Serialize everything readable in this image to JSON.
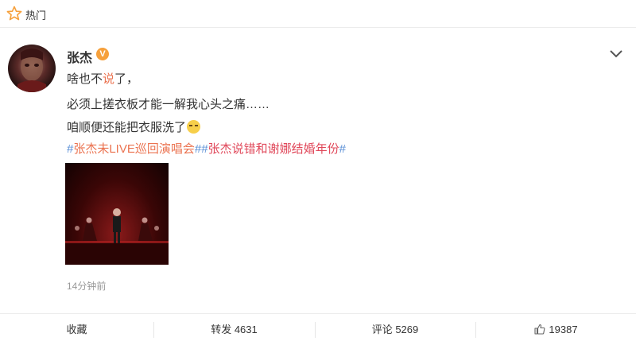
{
  "topbar": {
    "label": "热门",
    "icon": "star-icon"
  },
  "post": {
    "username": "张杰",
    "verified_badge": "V",
    "line1_pre": "啥也不",
    "line1_hl": "说",
    "line1_post": "了，",
    "line2": "必须上搓衣板才能一解我心头之痛……",
    "line3": "咱顺便还能把衣服洗了",
    "hashtag_symbol": "#",
    "tag1": "张杰未LIVE巡回演唱会",
    "tag2": "张杰说错和谢娜结婚年份",
    "time": "14分钟前"
  },
  "actions": {
    "favorite": "收藏",
    "repost": "转发 4631",
    "comment": "评论 5269",
    "like": "19387"
  },
  "colors": {
    "link": "#eb7350",
    "hashtag": "#5a8fd6",
    "badge": "#f6a03b"
  }
}
